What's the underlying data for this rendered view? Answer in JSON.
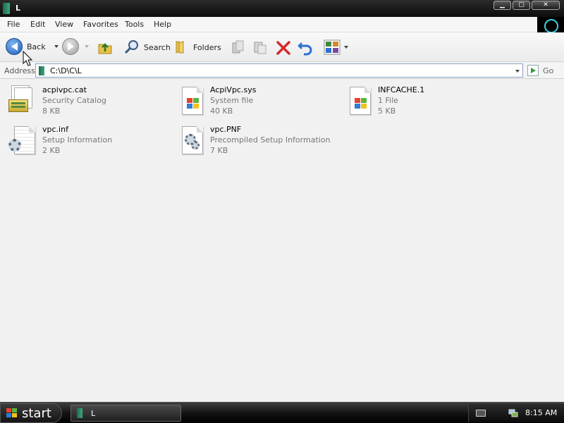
{
  "window": {
    "title": "L"
  },
  "menu": [
    "File",
    "Edit",
    "View",
    "Favorites",
    "Tools",
    "Help"
  ],
  "toolbar": {
    "back_label": "Back",
    "search_label": "Search",
    "folders_label": "Folders"
  },
  "address": {
    "label": "Address",
    "value": "C:\\D\\C\\L",
    "go_label": "Go"
  },
  "files": [
    {
      "name": "acpivpc.cat",
      "type": "Security Catalog",
      "size": "8 KB",
      "icon": "security-catalog-icon"
    },
    {
      "name": "AcpiVpc.sys",
      "type": "System file",
      "size": "40 KB",
      "icon": "system-file-icon"
    },
    {
      "name": "INFCACHE.1",
      "type": "1 File",
      "size": "5 KB",
      "icon": "generic-file-icon"
    },
    {
      "name": "vpc.inf",
      "type": "Setup Information",
      "size": "2 KB",
      "icon": "setup-information-icon"
    },
    {
      "name": "vpc.PNF",
      "type": "Precompiled Setup Information",
      "size": "7 KB",
      "icon": "precompiled-setup-icon"
    }
  ],
  "taskbar": {
    "start_label": "start",
    "task_label": "L",
    "clock": "8:15 AM"
  },
  "colors": {
    "titlebar": "#1a1a1a",
    "content_bg": "#f1f1f1",
    "accent_blue": "#1d5eb5",
    "delete_red": "#d42a2a"
  }
}
